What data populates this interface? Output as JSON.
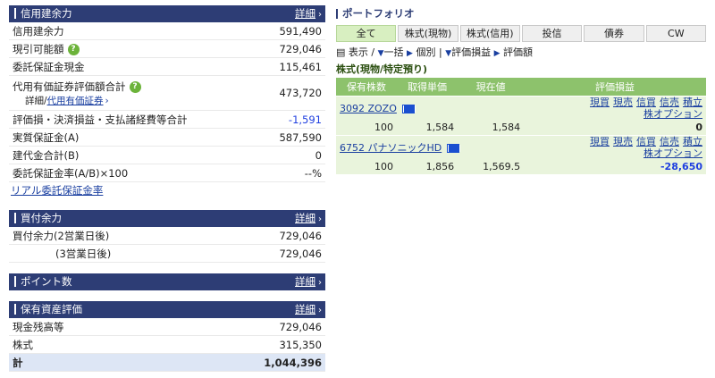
{
  "sections": {
    "credit": {
      "title": "信用建余力",
      "detail_label": "詳細",
      "rows": [
        {
          "label": "信用建余力",
          "value": "591,490"
        },
        {
          "label": "現引可能額",
          "value": "729,046"
        },
        {
          "label": "委託保証金現金",
          "value": "115,461"
        },
        {
          "label": "代用有価証券評価額合計",
          "value": "473,720"
        },
        {
          "label": "評価損・決済損益・支払諸経費等合計",
          "value": "-1,591"
        },
        {
          "label": "実質保証金(A)",
          "value": "587,590"
        },
        {
          "label": "建代金合計(B)",
          "value": "0"
        },
        {
          "label": "委託保証金率(A/B)×100",
          "value": "--%"
        }
      ],
      "sub_prefix": "詳細/",
      "sub_link": "代用有価証券",
      "footer_link": "リアル委託保証金率",
      "help_glyph": "?"
    },
    "buying": {
      "title": "買付余力",
      "detail_label": "詳細",
      "rows": [
        {
          "label": "買付余力(2営業日後)",
          "value": "729,046"
        },
        {
          "label": "(3営業日後)",
          "value": "729,046"
        }
      ]
    },
    "points": {
      "title": "ポイント数",
      "detail_label": "詳細"
    },
    "assets": {
      "title": "保有資産評価",
      "detail_label": "詳細",
      "rows": [
        {
          "label": "現金残高等",
          "value": "729,046"
        },
        {
          "label": "株式",
          "value": "315,350"
        }
      ],
      "total_label": "計",
      "total_value": "1,044,396"
    }
  },
  "portfolio": {
    "title": "ポートフォリオ",
    "tabs": [
      "全て",
      "株式(現物)",
      "株式(信用)",
      "投信",
      "債券",
      "CW"
    ],
    "controls": {
      "display": "表示",
      "bulk": "一括",
      "individual": "個別",
      "pl": "評価損益",
      "amount": "評価額",
      "sep": "/",
      "sep2": "|"
    },
    "subtitle": "株式(現物/特定預り)",
    "columns": [
      "保有株数",
      "取得単価",
      "現在値",
      "評価損益"
    ],
    "holdings": [
      {
        "code_name": "3092 ZOZO",
        "shares": "100",
        "cost": "1,584",
        "price": "1,584",
        "pl": "0"
      },
      {
        "code_name": "6752 パナソニックHD",
        "shares": "100",
        "cost": "1,856",
        "price": "1,569.5",
        "pl": "-28,650"
      }
    ],
    "actions": [
      "現買",
      "現売",
      "信買",
      "信売",
      "積立"
    ],
    "option_link": "株オプション"
  },
  "icons": {
    "arrow": "›",
    "triangle": "▼",
    "right_triangle": "▶",
    "display_icon": "▤"
  },
  "colors": {
    "header": "#2d3d75",
    "tab_active": "#d8efc1",
    "table_header": "#8dc26c",
    "negative": "#1f3fe0"
  }
}
